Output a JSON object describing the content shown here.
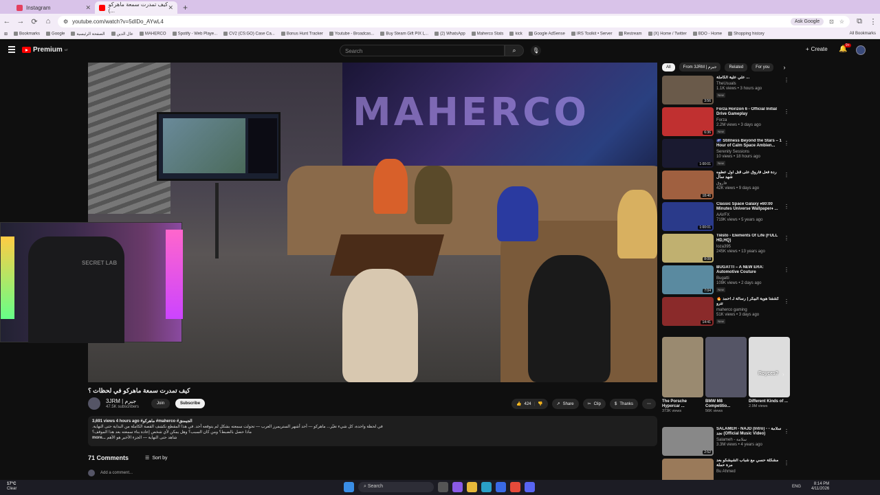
{
  "browser": {
    "tabs": [
      {
        "label": "Instagram",
        "color": "#e4405f"
      },
      {
        "label": "كيف تمدرت سمعة ماهركو (... ",
        "color": "#ff0000"
      }
    ],
    "new_tab": "+",
    "url": "youtube.com/watch?v=5dIDo_AYwL4",
    "ask_google": "Ask Google",
    "bookmarks": [
      "Bookmarks",
      "Google",
      "الصفحة الرئيسية",
      "عال الدين",
      "MAHERCO",
      "Spotify - Web Playe...",
      "CV2 (CS:GO) Case Ca...",
      "Bonus Hunt Tracker",
      "Youtube - Broadcas...",
      "Buy Steam Gift PIX L...",
      "(2) WhatsApp",
      "Maherco Stats",
      "kick",
      "Google AdSense",
      "IRS Toolkit • Server",
      "Restream",
      "(X) Home / Twitter",
      "BDO - Home",
      "Shopping history"
    ],
    "all_bookmarks": "All Bookmarks"
  },
  "youtube": {
    "logo": "Premium",
    "logo_sup": "NT",
    "search_placeholder": "Search",
    "create": "Create",
    "notif_count": "9+"
  },
  "video": {
    "mural_text": "MAHERCO",
    "cam_text": "SECRET LAB",
    "title": "كيف تمدرت سمعة ماهركو في لحظات ؟",
    "channel": "3JRM | جيرم",
    "subs": "47.5K subscribers",
    "join": "Join",
    "subscribe": "Subscribe",
    "likes": "424",
    "share": "Share",
    "clip": "Clip",
    "thanks": "Thanks",
    "desc_meta": "3,691 views  4 hours ago  #ماهركو #maherco #الجيمنق",
    "desc_lines": [
      "في لحظة واحدة، كل شيء تغيّر... ماهركو — أحد أشهر الستريمرز العرب — تحولت سمعته بشكل لم يتوقعه أحد. في هذا المقطع نكشف القصة الكاملة من البداية حتى النهاية.",
      "ماذا حصل بالضبط؟ ومن كان السبب؟ وهل يمكن لأي شخص إعادة بناء سمعته بعد هذا الموقف؟",
      "شاهد حتى النهاية — الجزء الأخير هو الأهم"
    ],
    "more": "...more",
    "comments_count": "71 Comments",
    "sort": "Sort by",
    "add_comment": "Add a comment..."
  },
  "chips": [
    "All",
    "From 3JRM | جيرم",
    "Related",
    "For you"
  ],
  "recs": [
    {
      "title": "علي علية الكاملة ...",
      "channel": "TheUsuals",
      "views": "1.1K views • 3 hours ago",
      "new": "New",
      "dur": "3:56",
      "color": "#6a5a4a"
    },
    {
      "title": "Forza Horizon 6 - Official Initial Drive Gameplay",
      "channel": "Forza",
      "views": "2.2M views • 3 days ago",
      "new": "New",
      "dur": "6:36",
      "color": "#c03030"
    },
    {
      "title": "🌌 Stillness Beyond the Stars – 1 Hour of Calm Space Ambien...",
      "channel": "Serenity Sessions",
      "views": "10 views • 18 hours ago",
      "new": "New",
      "dur": "1:00:01",
      "color": "#1a1a30"
    },
    {
      "title": "ردة فعل فاروق على قتل اول عطوه شهد سال",
      "channel": "فاروق",
      "views": "42K views • 9 days ago",
      "new": "",
      "dur": "18:46",
      "color": "#a06040"
    },
    {
      "title": "Classic Space Galaxy ♦60:00 Minutes Universe Wallpaper♦ ...",
      "channel": "AAVFX",
      "views": "719K views • 5 years ago",
      "new": "",
      "dur": "1:00:01",
      "color": "#2a3a8a"
    },
    {
      "title": "Tiësto - Elements Of Life (FULL HD,HQ)",
      "channel": "loza395",
      "views": "245K views • 13 years ago",
      "new": "",
      "dur": "8:08",
      "color": "#c0b070"
    },
    {
      "title": "BUGATTI – A NEW ERA: Automotive Couture",
      "channel": "Bugatti",
      "views": "109K views • 2 days ago",
      "new": "New",
      "dur": "7:04",
      "color": "#5a8aa0"
    },
    {
      "title": "🔥 كشفنا هوية البيكر | رسالة لـ أحمد تترو",
      "channel": "maherco gaming",
      "views": "51K views • 3 days ago",
      "new": "New",
      "dur": "14:41",
      "color": "#8a2a2a"
    }
  ],
  "shorts": [
    {
      "title": "The Porsche Hypercar ...",
      "views": "373K views",
      "color": "#9a8a70"
    },
    {
      "title": "BMW M8 Competitio...",
      "views": "56K views",
      "color": "#556"
    },
    {
      "title": "Different Kinds of ...",
      "views": "2.9M views",
      "color": "#ddd",
      "overlay": "Royces?"
    }
  ],
  "recs2": [
    {
      "title": "SALAMEH - NAJD (Intro) - سلامة - نجد (Official Music Video)",
      "channel": "Salameh - سلامة",
      "views": "3.3M views • 4 years ago",
      "dur": "2:52",
      "color": "#888"
    },
    {
      "title": "مشكلة حسي مع شباب الشيشكو بعد مرة حملة",
      "channel": "Bu Ahmed",
      "views": "",
      "dur": "",
      "color": "#9a7a5a"
    }
  ],
  "taskbar": {
    "temp": "17°C",
    "cond": "Clear",
    "search": "Search",
    "lang": "ENG",
    "time": "8:14 PM",
    "date": "4/11/2026"
  }
}
